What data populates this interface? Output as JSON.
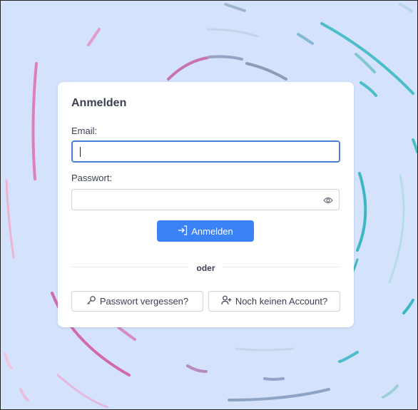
{
  "login": {
    "title": "Anmelden",
    "email_label": "Email:",
    "email_value": "",
    "password_label": "Passwort:",
    "password_value": "",
    "submit_label": "Anmelden",
    "divider_text": "oder",
    "forgot_label": "Passwort vergessen?",
    "register_label": "Noch keinen Account?"
  },
  "icons": {
    "submit": "login-arrow-icon",
    "password_toggle": "eye-icon",
    "forgot": "key-icon",
    "register": "user-plus-icon"
  },
  "colors": {
    "background": "#d4e3fb",
    "primary": "#3b82f6",
    "focus_border": "#4a7fd6",
    "text": "#3b4151"
  }
}
